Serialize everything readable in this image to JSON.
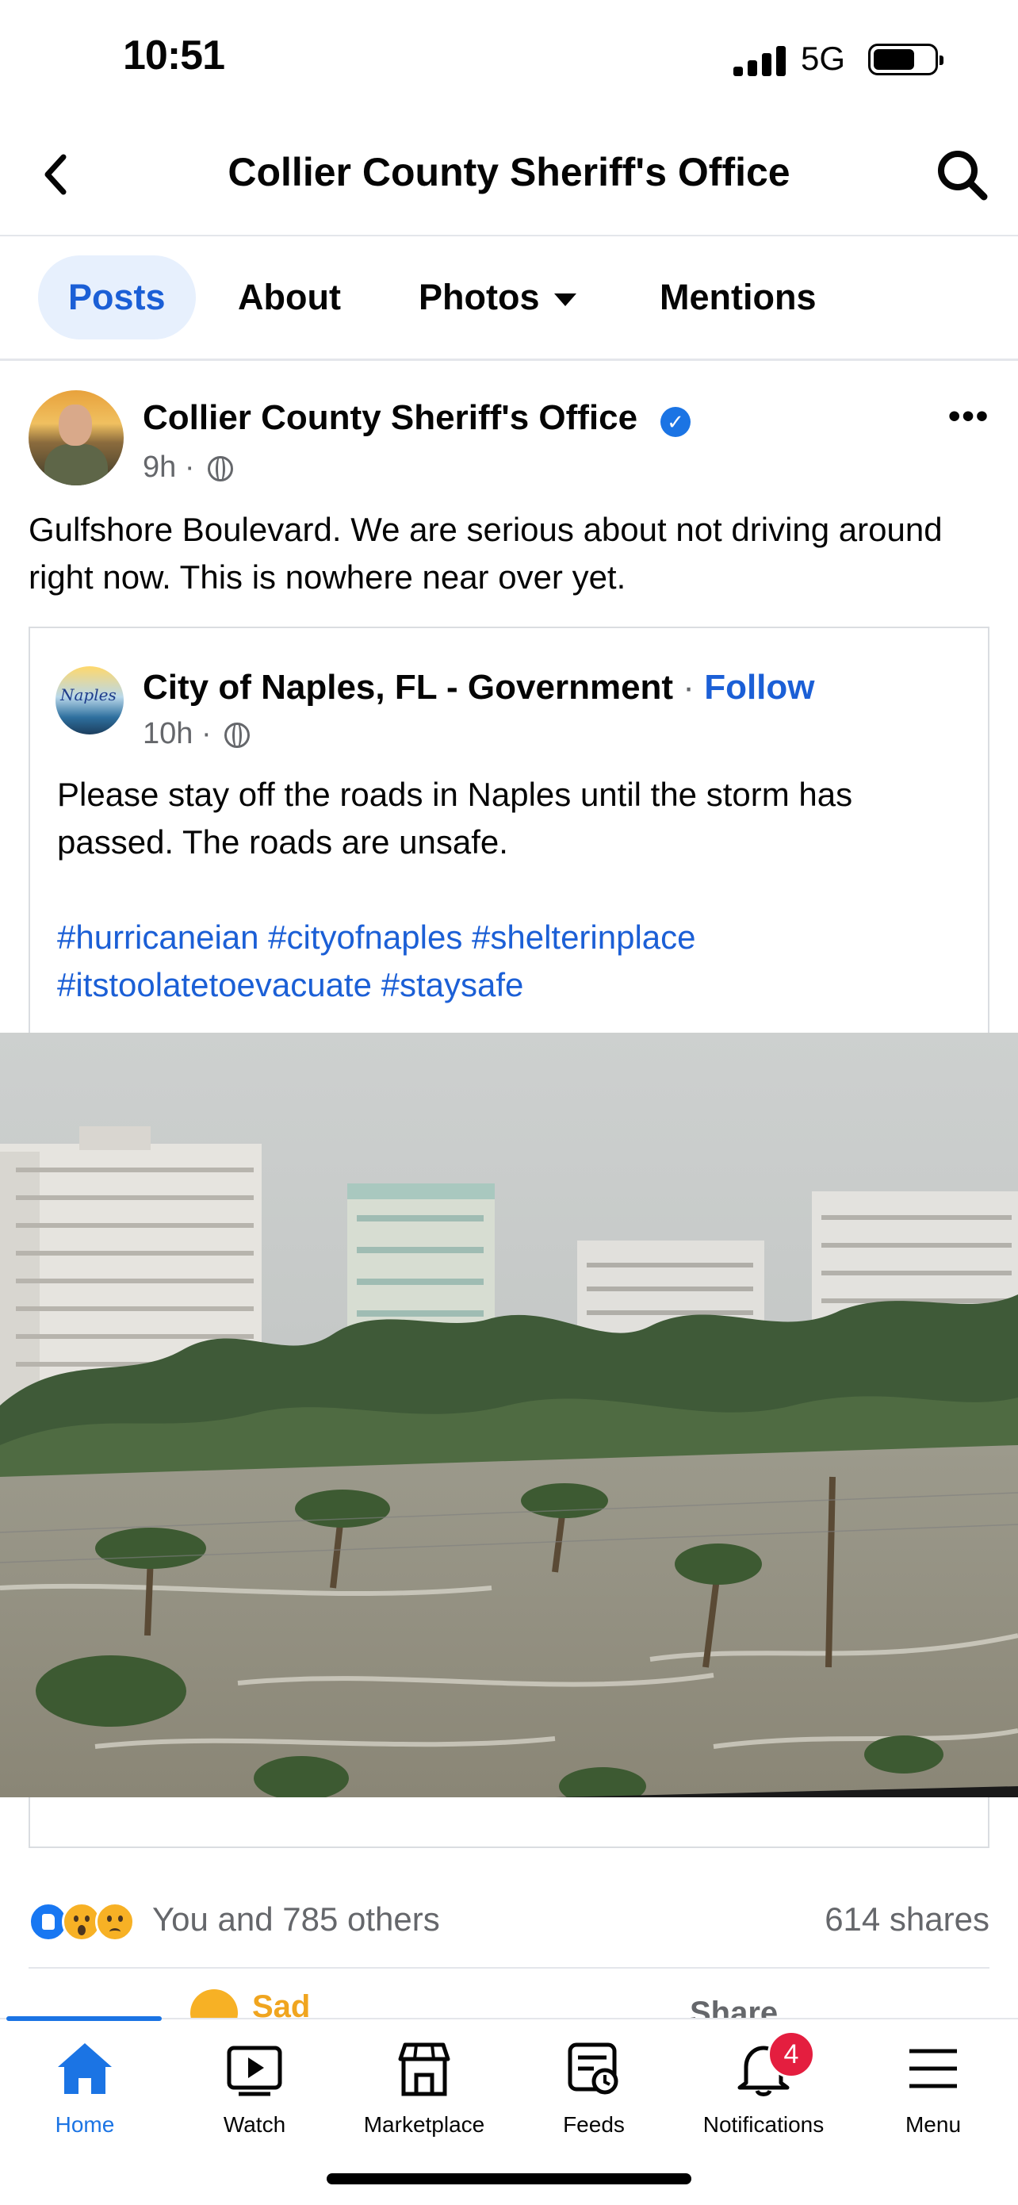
{
  "status_bar": {
    "time": "10:51",
    "network": "5G"
  },
  "header": {
    "title": "Collier County Sheriff's Office"
  },
  "tabs": [
    {
      "label": "Posts",
      "active": true
    },
    {
      "label": "About",
      "active": false
    },
    {
      "label": "Photos",
      "active": false
    },
    {
      "label": "Mentions",
      "active": false
    }
  ],
  "post": {
    "author": "Collier County Sheriff's Office",
    "time": "9h",
    "meta_sep": "·",
    "text": "Gulfshore Boulevard. We are serious about not driving around right now.  This is nowhere near over yet.",
    "more_label": "•••",
    "shared": {
      "author": "City of Naples, FL - Government",
      "sep": " · ",
      "follow_label": "Follow",
      "time": "10h",
      "meta_sep": "·",
      "text": "Please stay off the roads in Naples until the storm has passed.  The roads are unsafe.",
      "hashtags": "#hurricaneian #cityofnaples #shelterinplace #itstoolatetoevacuate #staysafe",
      "avatar_text": "Naples"
    },
    "reactions_text": "You and 785 others",
    "shares_text": "614 shares",
    "peek_actions": {
      "sad": "Sad",
      "share": "Share"
    }
  },
  "bottom_nav": [
    {
      "label": "Home",
      "icon": "home-icon",
      "active": true
    },
    {
      "label": "Watch",
      "icon": "watch-icon",
      "active": false
    },
    {
      "label": "Marketplace",
      "icon": "marketplace-icon",
      "active": false
    },
    {
      "label": "Feeds",
      "icon": "feeds-icon",
      "active": false
    },
    {
      "label": "Notifications",
      "icon": "bell-icon",
      "active": false
    },
    {
      "label": "Menu",
      "icon": "menu-icon",
      "active": false
    }
  ],
  "notifications_badge": "4",
  "colors": {
    "accent": "#1b74e4",
    "link": "#1b5fd6",
    "badge": "#e41e3f",
    "secondary_text": "#65676b"
  }
}
